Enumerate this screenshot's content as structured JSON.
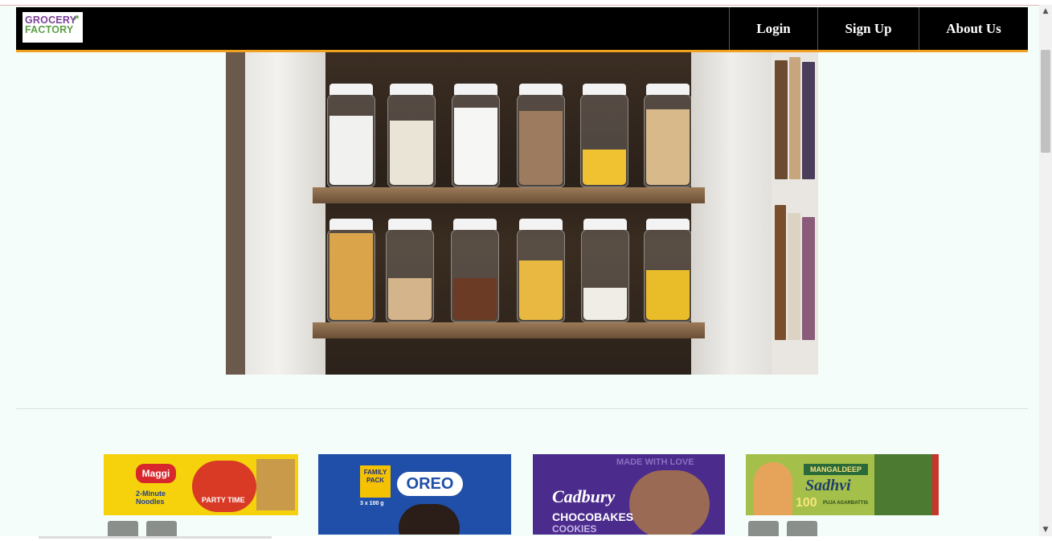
{
  "logo": {
    "line1": "GROCERY",
    "line2": "FACTORY"
  },
  "nav": {
    "login": "Login",
    "signup": "Sign Up",
    "about": "About Us"
  },
  "products": {
    "maggi": {
      "brand": "Maggi",
      "label": "2-Minute Noodles",
      "tag": "PARTY TIME"
    },
    "oreo": {
      "brand": "OREO",
      "tag": "FAMILY PACK",
      "count": "3 x 100 g"
    },
    "cadbury": {
      "brand": "Cadbury",
      "name": "CHOCOBAKES",
      "sub": "COOKIES",
      "top": "MADE WITH LOVE"
    },
    "sadhvi": {
      "brand": "MANGALDEEP",
      "name": "Sadhvi",
      "count": "100",
      "sub": "PUJA AGARBATTIS"
    }
  },
  "colors": {
    "nav_bg": "#000000",
    "nav_border": "#f0a020",
    "page_bg": "#f4fdf9"
  }
}
